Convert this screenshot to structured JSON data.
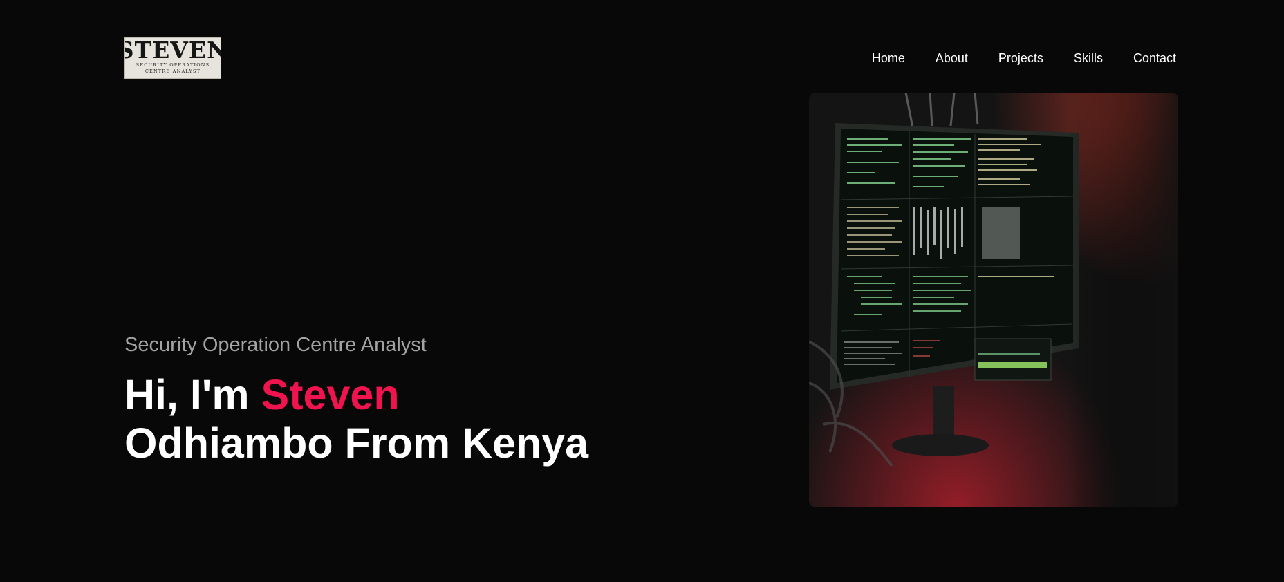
{
  "brand": {
    "logo_word": "STEVEN",
    "logo_tagline_1": "SECURITY OPERATIONS",
    "logo_tagline_2": "CENTRE ANALYST"
  },
  "nav": {
    "items": [
      "Home",
      "About",
      "Projects",
      "Skills",
      "Contact"
    ]
  },
  "hero": {
    "subtitle": "Security Operation Centre Analyst",
    "greeting": "Hi, I'm ",
    "first_name": "Steven",
    "rest_line": "Odhiambo From Kenya",
    "image_icon": "hacker-monitor-photo"
  },
  "colors": {
    "background": "#080808",
    "accent": "#f0144e",
    "text": "#ffffff",
    "muted": "#a3a3a3"
  }
}
